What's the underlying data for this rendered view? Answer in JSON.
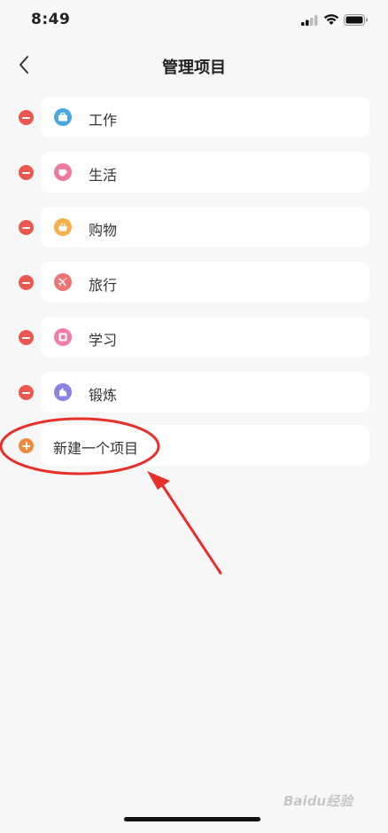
{
  "status_bar": {
    "time": "8:49"
  },
  "nav": {
    "title": "管理项目"
  },
  "items": [
    {
      "label": "工作",
      "icon": "briefcase-icon",
      "color": "#4aa8e0"
    },
    {
      "label": "生活",
      "icon": "coffee-cup-icon",
      "color": "#ef7aa0"
    },
    {
      "label": "购物",
      "icon": "shopping-basket-icon",
      "color": "#f4b04a"
    },
    {
      "label": "旅行",
      "icon": "airplane-icon",
      "color": "#ee7575"
    },
    {
      "label": "学习",
      "icon": "book-icon",
      "color": "#f07ea8"
    },
    {
      "label": "锻炼",
      "icon": "dumbbell-arm-icon",
      "color": "#8b82e6"
    }
  ],
  "add_item": {
    "label": "新建一个项目"
  },
  "colors": {
    "remove": "#e9584f",
    "add": "#f08a3c",
    "annotation": "#e8302a"
  },
  "watermark": {
    "text": "Baidu经验"
  }
}
